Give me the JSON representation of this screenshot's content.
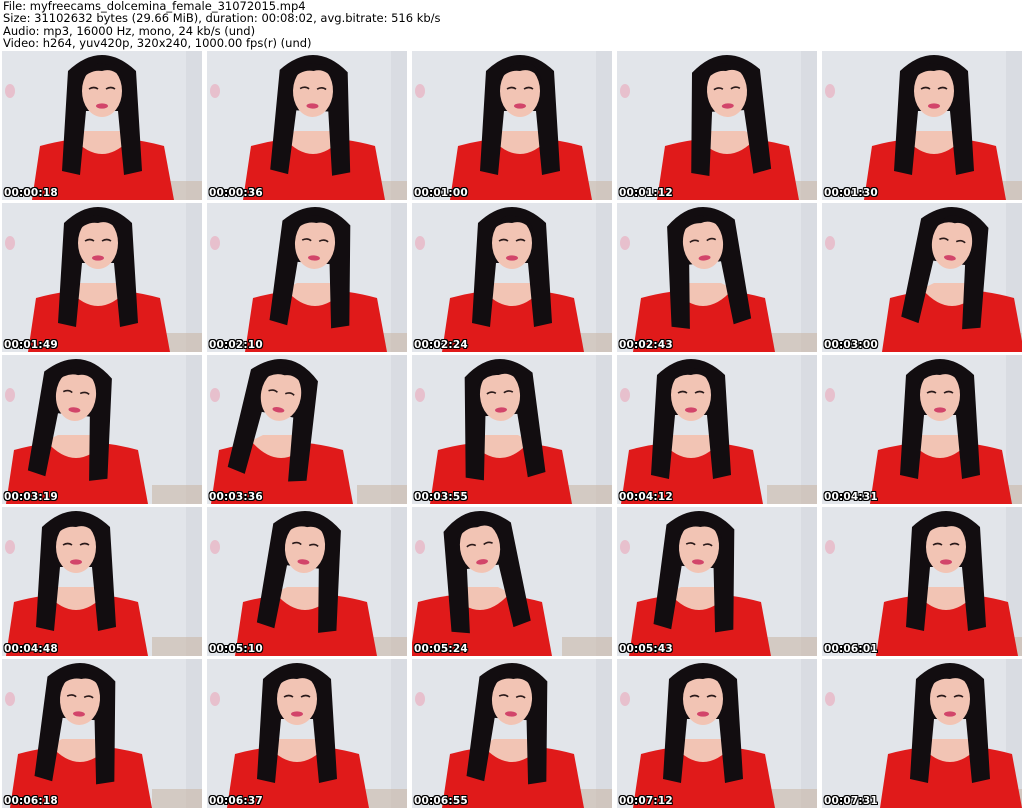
{
  "header": {
    "file": "File: myfreecams_dolcemina_female_31072015.mp4",
    "size": "Size: 31102632 bytes (29.66 MiB), duration: 00:08:02, avg.bitrate: 516 kb/s",
    "audio": "Audio: mp3, 16000 Hz, mono, 24 kb/s (und)",
    "video": "Video: h264, yuv420p, 320x240, 1000.00 fps(r) (und)"
  },
  "colors": {
    "dress": "#e01a1a",
    "hair": "#120d10",
    "skin": "#f2c4b4",
    "background": "#e2e5ea",
    "lips": "#d2456a"
  },
  "frames": [
    {
      "timestamp": "00:00:18"
    },
    {
      "timestamp": "00:00:36"
    },
    {
      "timestamp": "00:01:00"
    },
    {
      "timestamp": "00:01:12"
    },
    {
      "timestamp": "00:01:30"
    },
    {
      "timestamp": "00:01:49"
    },
    {
      "timestamp": "00:02:10"
    },
    {
      "timestamp": "00:02:24"
    },
    {
      "timestamp": "00:02:43"
    },
    {
      "timestamp": "00:03:00"
    },
    {
      "timestamp": "00:03:19"
    },
    {
      "timestamp": "00:03:36"
    },
    {
      "timestamp": "00:03:55"
    },
    {
      "timestamp": "00:04:12"
    },
    {
      "timestamp": "00:04:31"
    },
    {
      "timestamp": "00:04:48"
    },
    {
      "timestamp": "00:05:10"
    },
    {
      "timestamp": "00:05:24"
    },
    {
      "timestamp": "00:05:43"
    },
    {
      "timestamp": "00:06:01"
    },
    {
      "timestamp": "00:06:18"
    },
    {
      "timestamp": "00:06:37"
    },
    {
      "timestamp": "00:06:55"
    },
    {
      "timestamp": "00:07:12"
    },
    {
      "timestamp": "00:07:31"
    }
  ]
}
